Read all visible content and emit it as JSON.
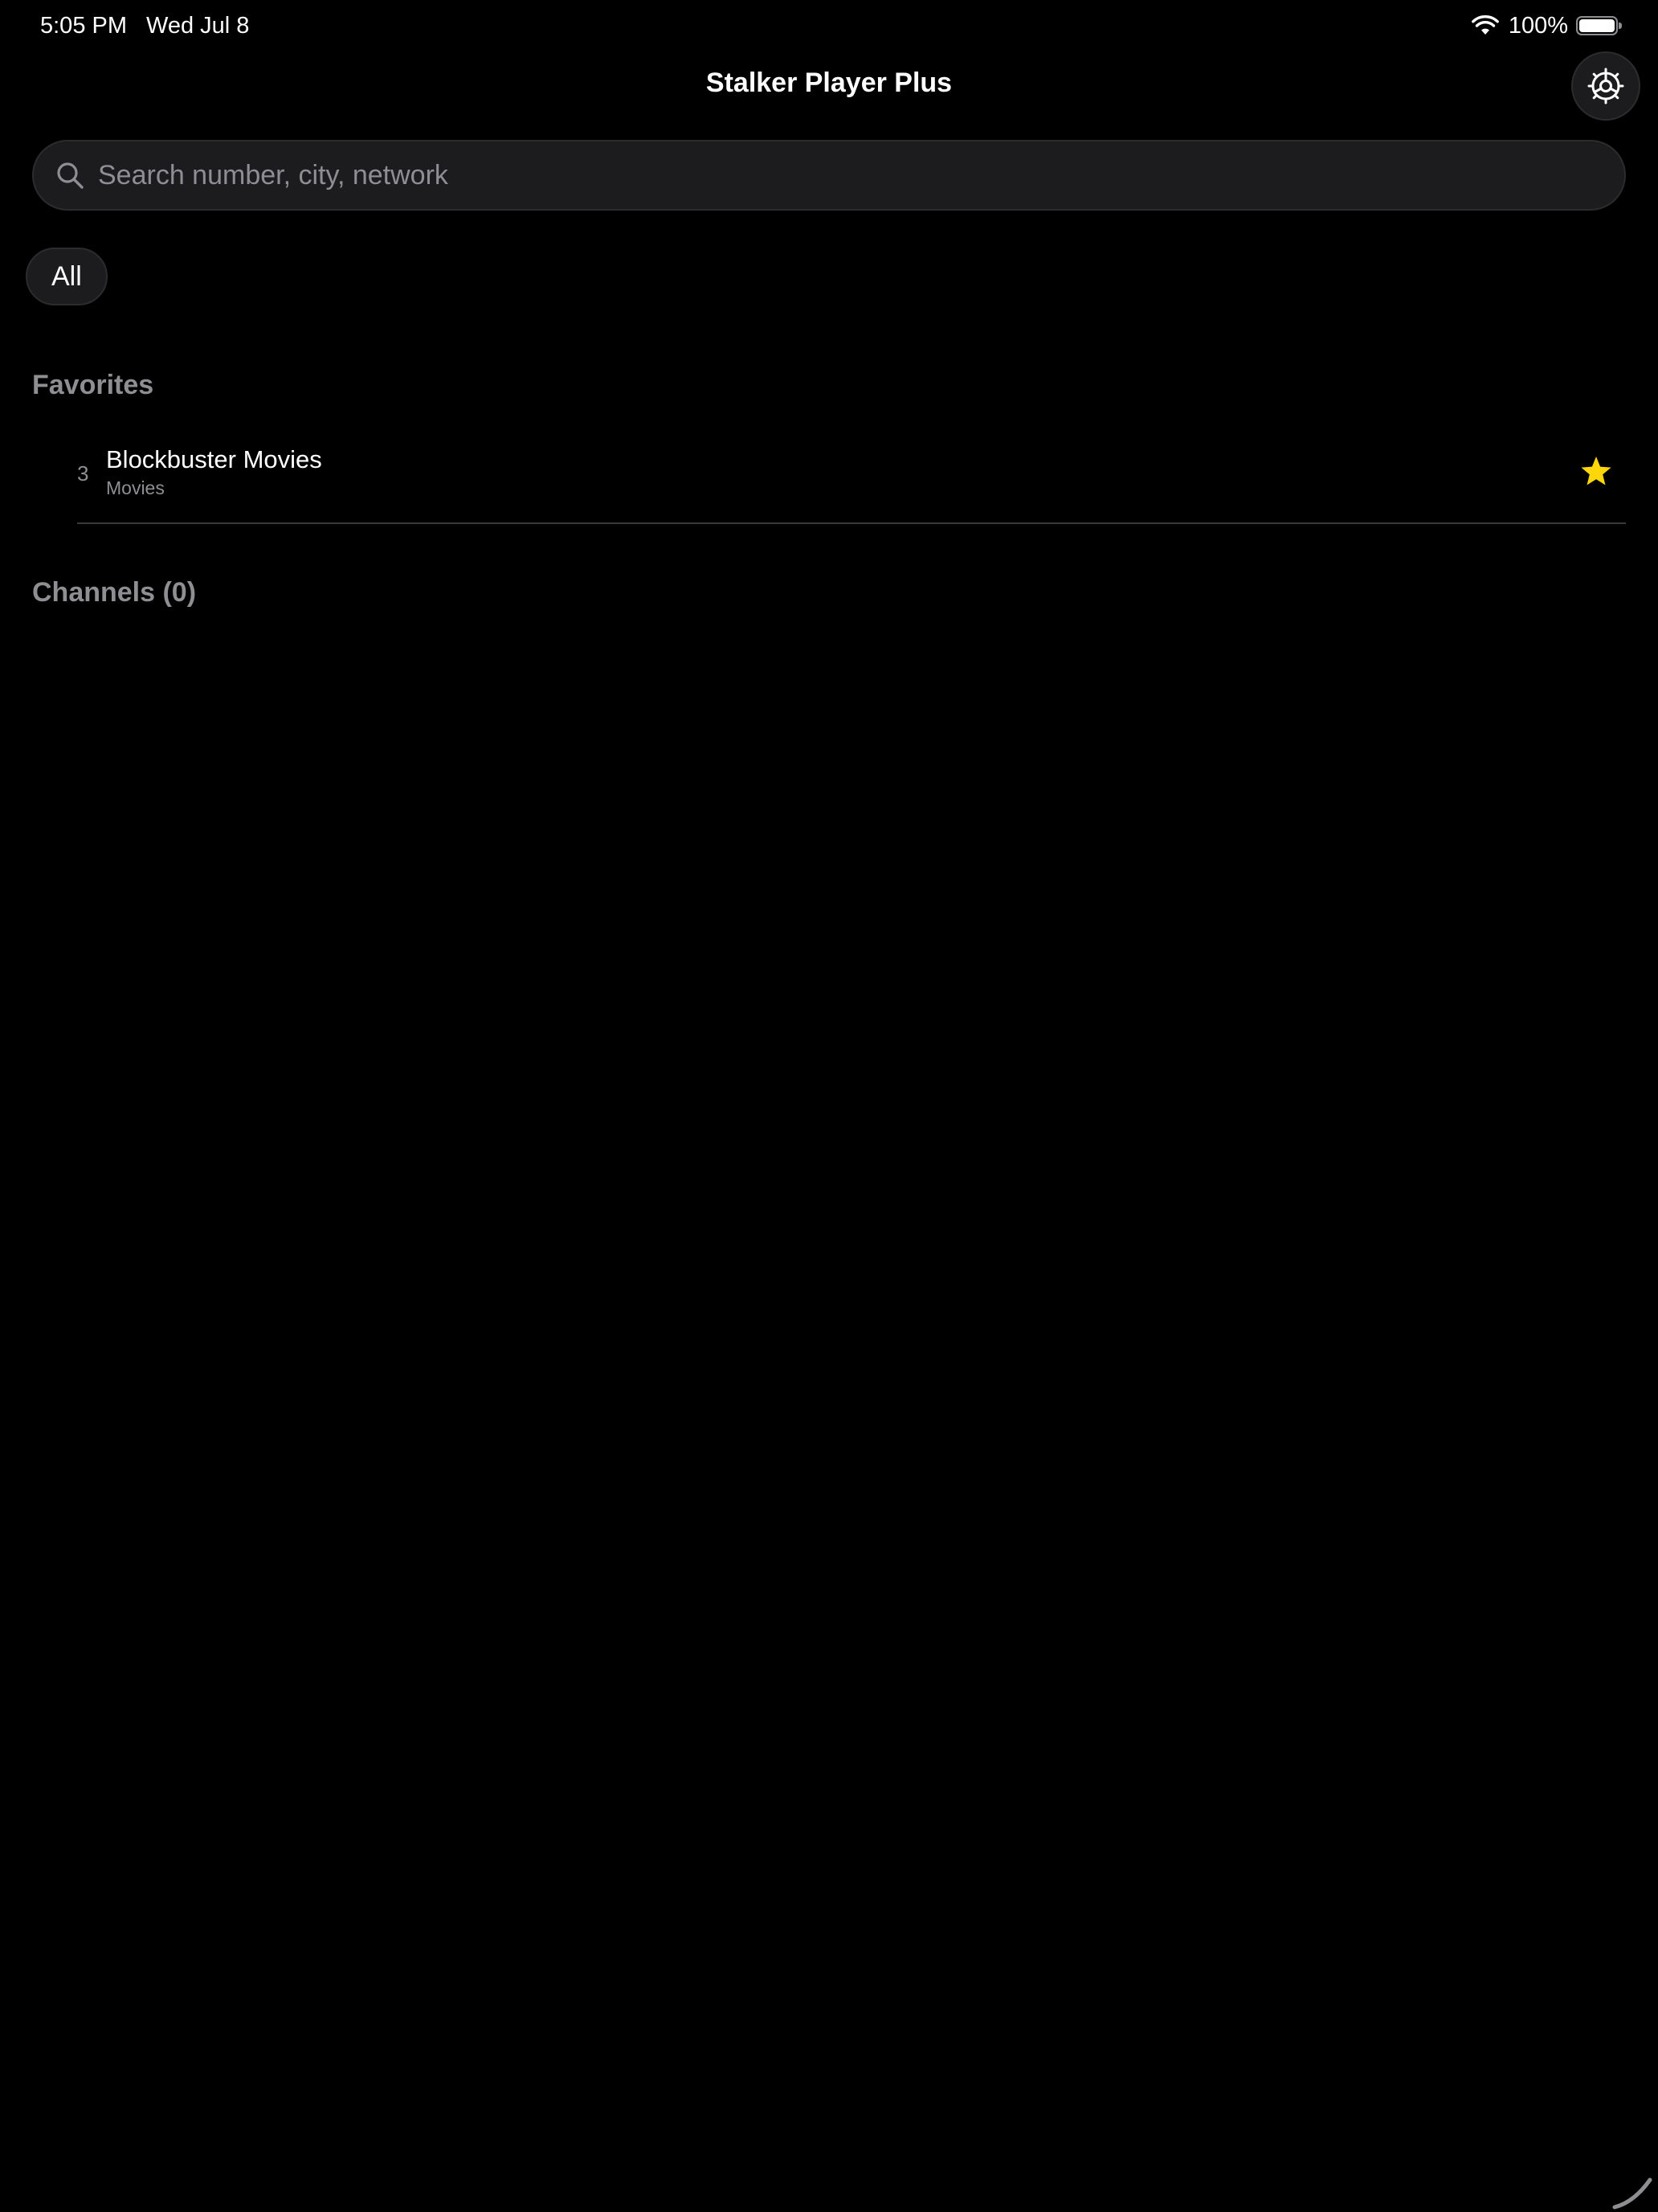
{
  "status_bar": {
    "time": "5:05 PM",
    "date": "Wed Jul 8",
    "battery_percent": "100%",
    "battery_level": 1.0,
    "wifi_icon": "wifi-icon",
    "battery_icon": "battery-icon"
  },
  "nav": {
    "title": "Stalker Player Plus",
    "settings_icon": "gear-icon"
  },
  "search": {
    "placeholder": "Search number, city, network",
    "value": "",
    "icon": "search-icon"
  },
  "filters": [
    {
      "label": "All",
      "selected": true
    }
  ],
  "favorites": {
    "header": "Favorites",
    "items": [
      {
        "number": "3",
        "name": "Blockbuster Movies",
        "category": "Movies",
        "favorite": true,
        "star_color": "#FFD60A"
      }
    ]
  },
  "channels": {
    "header": "Channels (0)"
  },
  "colors": {
    "background": "#000000",
    "surface": "#1C1C1E",
    "secondary_text": "#8E8E93",
    "accent_star": "#FFD60A"
  }
}
